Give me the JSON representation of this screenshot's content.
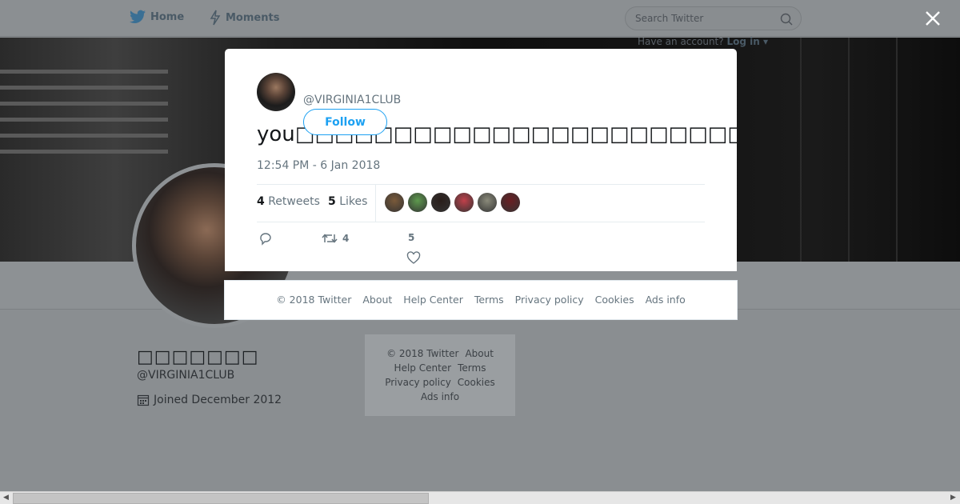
{
  "nav": {
    "home_label": "Home",
    "moments_label": "Moments",
    "search_placeholder": "Search Twitter",
    "have_account_text": "Have an account?",
    "login_label": "Log in"
  },
  "profile": {
    "name": "□□□□□□□",
    "handle": "@VIRGINIA1CLUB",
    "joined": "Joined December 2012"
  },
  "side_footer": {
    "copyright": "© 2018 Twitter",
    "about": "About",
    "help": "Help Center",
    "terms": "Terms",
    "privacy": "Privacy policy",
    "cookies": "Cookies",
    "ads": "Ads info"
  },
  "tweet": {
    "handle": "@VIRGINIA1CLUB",
    "follow_label": "Follow",
    "text": "you□□□□□□□□□□□□□□□□□□□□□□□□□□□□□□□□□□□□□□□□□□□□□□□□□□□□□□□□□",
    "timestamp": "12:54 PM - 6 Jan 2018",
    "retweets_count": "4",
    "retweets_label": "Retweets",
    "likes_count": "5",
    "likes_label": "Likes",
    "reply_count": "",
    "retweet_action_count": "4",
    "like_action_count": "5",
    "likers": [
      {
        "color": "#7a5a3a"
      },
      {
        "color": "#5e9a4e"
      },
      {
        "color": "#2a1e1a"
      },
      {
        "color": "#c0404a"
      },
      {
        "color": "#8a8a7a"
      },
      {
        "color": "#6a1e22"
      }
    ]
  },
  "modal_footer": {
    "copyright": "© 2018 Twitter",
    "about": "About",
    "help": "Help Center",
    "terms": "Terms",
    "privacy": "Privacy policy",
    "cookies": "Cookies",
    "ads": "Ads info"
  },
  "colors": {
    "twitter_blue": "#1da1f2",
    "overlay_gray": "#8a8e91",
    "muted_text": "#66757f"
  }
}
